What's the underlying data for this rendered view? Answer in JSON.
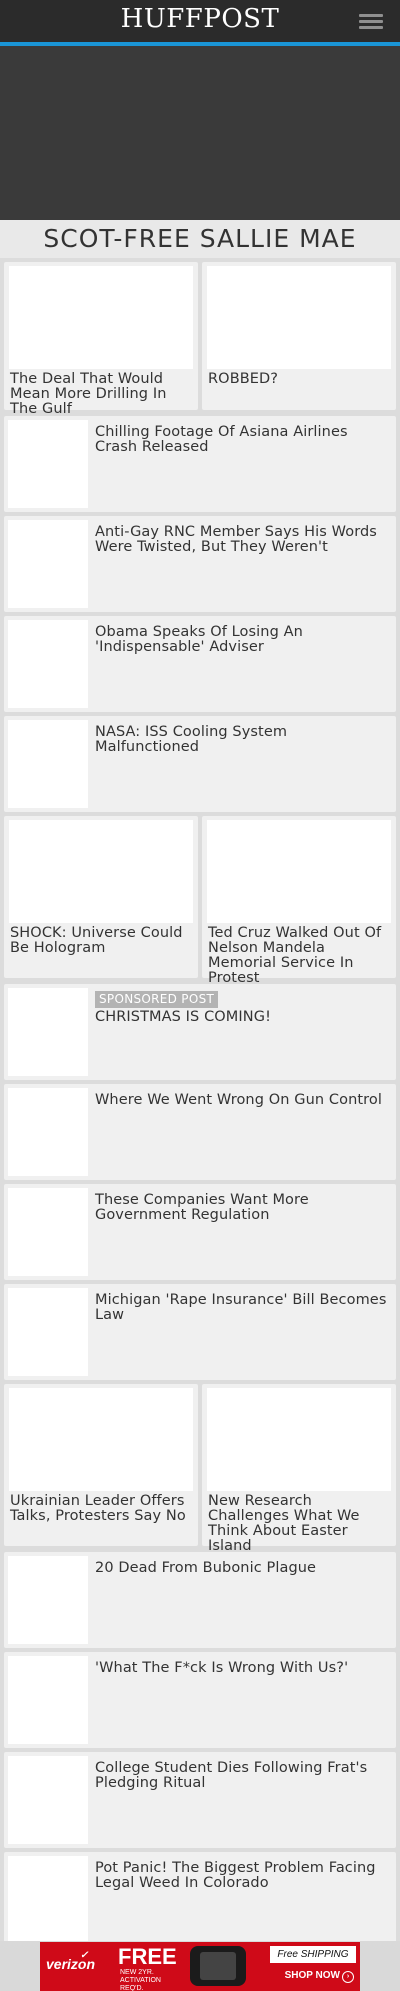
{
  "header": {
    "logo": "HUFFPOST",
    "accent_color": "#1a95d6",
    "menu_icon": "hamburger-menu-icon"
  },
  "section": {
    "title": "SCOT-FREE SALLIE MAE"
  },
  "stories": [
    {
      "headline": "The Deal That Would Mean More Drilling In The Gulf"
    },
    {
      "headline": "ROBBED?"
    },
    {
      "headline": "Chilling Footage Of Asiana Airlines Crash Released"
    },
    {
      "headline": "Anti-Gay RNC Member Says His Words Were Twisted, But They Weren't"
    },
    {
      "headline": "Obama Speaks Of Losing An 'Indispensable' Adviser"
    },
    {
      "headline": "NASA: ISS Cooling System Malfunctioned"
    },
    {
      "headline": "SHOCK: Universe Could Be Hologram"
    },
    {
      "headline": "Ted Cruz Walked Out Of Nelson Mandela Memorial Service In Protest"
    },
    {
      "headline": "CHRISTMAS IS COMING!",
      "badge": "SPONSORED POST"
    },
    {
      "headline": "Where We Went Wrong On Gun Control"
    },
    {
      "headline": "These Companies Want More Government Regulation"
    },
    {
      "headline": "Michigan 'Rape Insurance' Bill Becomes Law"
    },
    {
      "headline": "Ukrainian Leader Offers Talks, Protesters Say No"
    },
    {
      "headline": "New Research Challenges What We Think About Easter Island"
    },
    {
      "headline": "20 Dead From Bubonic Plague"
    },
    {
      "headline": "'What The F*ck Is Wrong With Us?'"
    },
    {
      "headline": "College Student Dies Following Frat's Pledging Ritual"
    },
    {
      "headline": "Pot Panic! The Biggest Problem Facing Legal Weed In Colorado"
    }
  ],
  "ad": {
    "brand": "verizon",
    "headline": "FREE",
    "fine_print": "NEW 2YR. ACTIVATION REQ'D.",
    "shipping": "Free SHIPPING",
    "cta": "SHOP NOW",
    "color": "#cf0a18"
  }
}
